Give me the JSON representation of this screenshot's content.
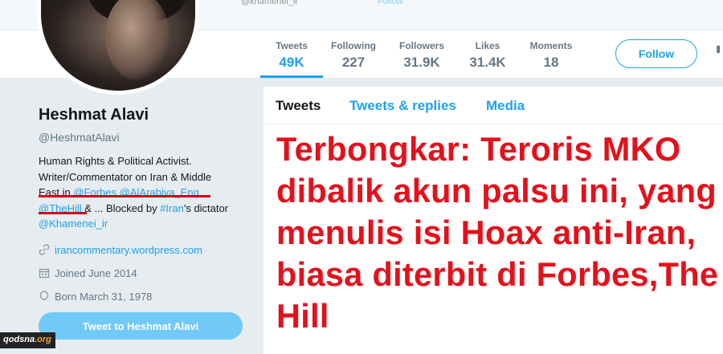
{
  "topbar": {
    "mention": "@khamenei_ir",
    "faint": "Follow"
  },
  "stats": [
    {
      "label": "Tweets",
      "value": "49K",
      "active": true
    },
    {
      "label": "Following",
      "value": "227"
    },
    {
      "label": "Followers",
      "value": "31.9K"
    },
    {
      "label": "Likes",
      "value": "31.4K"
    },
    {
      "label": "Moments",
      "value": "18"
    }
  ],
  "follow_button": "Follow",
  "profile": {
    "name": "Heshmat Alavi",
    "handle": "@HeshmatAlavi",
    "bio_line1": "Human Rights & Political Activist.",
    "bio_line2": "Writer/Commentator on Iran & Middle",
    "bio_line3_text": "East in ",
    "bio_forbes": "@Forbes",
    "bio_alarabiya": "@AlArabiya_Eng",
    "bio_thehill": "@TheHill",
    "bio_mid": " & ... Blocked by ",
    "bio_iran": "#Iran",
    "bio_tail": "'s dictator",
    "bio_khamenei": "@Khamenei_ir",
    "website": "irancommentary.wordpress.com",
    "joined": "Joined June 2014",
    "born": "Born March 31, 1978",
    "tweet_to": "Tweet to Heshmat Alavi"
  },
  "tabs": {
    "tweets": "Tweets",
    "replies": "Tweets & replies",
    "media": "Media"
  },
  "headline": "Terbongkar: Teroris MKO dibalik akun palsu ini, yang menulis isi Hoax anti-Iran, biasa diterbit di Forbes,The Hill",
  "watermark": {
    "part1": "qodsna",
    "part2": ".org"
  },
  "colors": {
    "accent": "#1da1f2",
    "headline": "#e4111b",
    "underline": "#d0021b"
  },
  "icons": [
    "link-icon",
    "calendar-icon",
    "balloon-icon",
    "more-icon"
  ]
}
